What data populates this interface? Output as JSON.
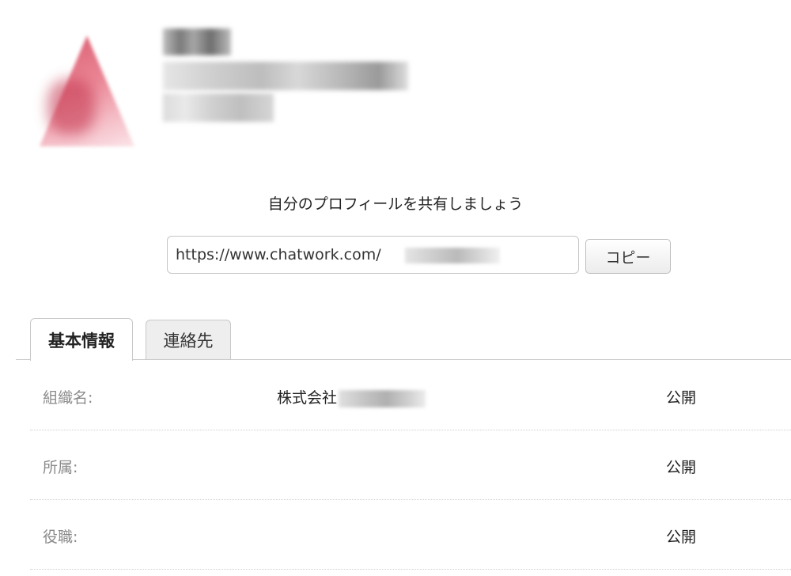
{
  "profile": {
    "avatar_icon": "pixelated-avatar-icon"
  },
  "share": {
    "title": "自分のプロフィールを共有しましょう",
    "url_value": "https://www.chatwork.com/",
    "copy_label": "コピー"
  },
  "tabs": [
    {
      "label": "基本情報",
      "active": true
    },
    {
      "label": "連絡先",
      "active": false
    }
  ],
  "rows": [
    {
      "label": "組織名:",
      "value": "株式会社",
      "visibility": "公開"
    },
    {
      "label": "所属:",
      "value": "",
      "visibility": "公開"
    },
    {
      "label": "役職:",
      "value": "",
      "visibility": "公開"
    }
  ],
  "colors": {
    "accent": "#d64a60",
    "label_gray": "#8a8a8a",
    "border": "#c8c8c8"
  }
}
